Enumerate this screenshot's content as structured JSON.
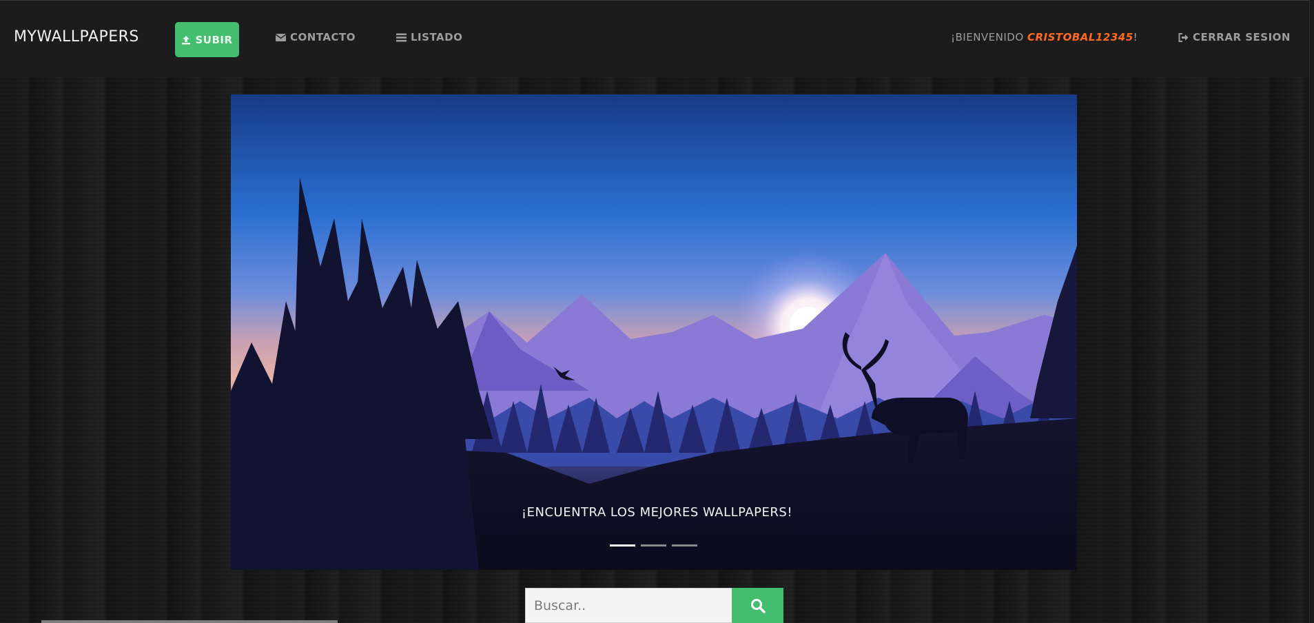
{
  "nav": {
    "brand": "MYWALLPAPERS",
    "upload_label": "SUBIR",
    "contact_label": "CONTACTO",
    "list_label": "LISTADO",
    "welcome_prefix": "¡BIENVENIDO ",
    "username": "CRISTOBAL12345",
    "welcome_suffix": "!",
    "logout_label": "CERRAR SESION"
  },
  "carousel": {
    "caption": "¡ENCUENTRA LOS MEJORES WALLPAPERS!",
    "slides_count": 3,
    "active_slide": 1
  },
  "search": {
    "placeholder": "Buscar.."
  },
  "icons": {
    "upload": "upload-icon",
    "contact": "envelope-icon",
    "list": "list-icon",
    "logout": "sign-out-icon",
    "search": "search-icon"
  },
  "colors": {
    "accent_green": "#45bd6f",
    "username_orange": "#ff6a1f",
    "navbar_bg": "#1c1c1c"
  }
}
